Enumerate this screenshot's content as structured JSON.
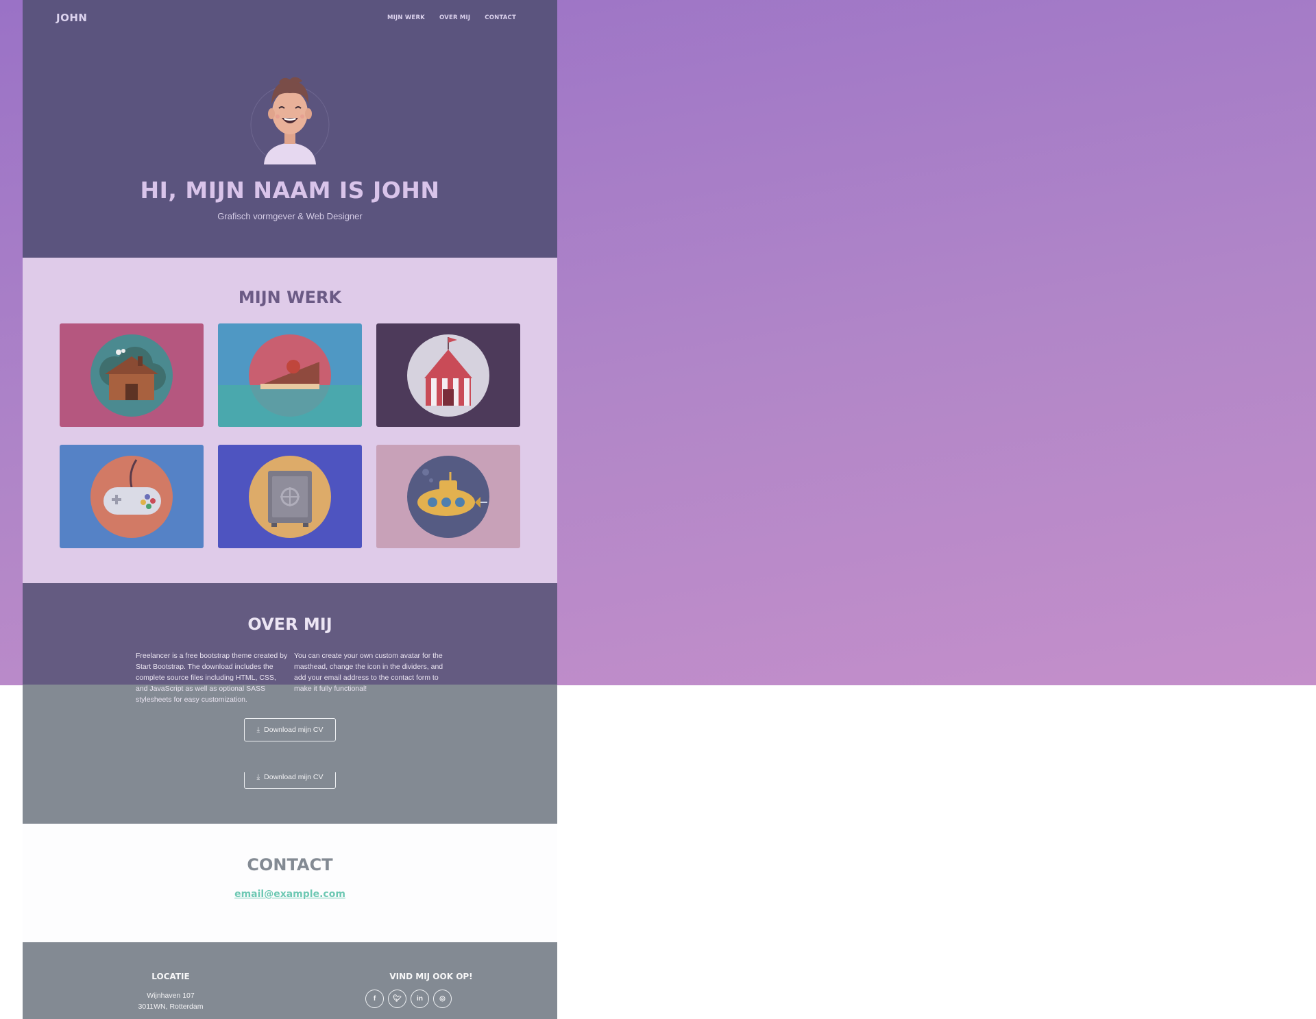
{
  "nav": {
    "brand": "JOHN",
    "links": [
      "MIJN WERK",
      "OVER MIJ",
      "CONTACT"
    ]
  },
  "hero": {
    "title": "HI, MIJN NAAM IS JOHN",
    "subtitle": "Grafisch vormgever & Web Designer",
    "avatar_icon": "avatar-illustration"
  },
  "work": {
    "title": "MIJN WERK",
    "items": [
      {
        "name": "cabin",
        "bg": "#b5577f",
        "circle": "#4b8a90"
      },
      {
        "name": "cake",
        "bg": "#4f98c4",
        "circle": "#c95f70"
      },
      {
        "name": "circus",
        "bg": "#4d3a5a",
        "circle": "#d6d2de"
      },
      {
        "name": "game",
        "bg": "#5582c6",
        "circle": "#d27a65"
      },
      {
        "name": "safe",
        "bg": "#4e54c0",
        "circle": "#ddab69"
      },
      {
        "name": "submarine",
        "bg": "#c8a1b8",
        "circle": "#555b83"
      }
    ]
  },
  "about": {
    "title": "OVER MIJ",
    "left_text": "Freelancer is a free bootstrap theme created by Start Bootstrap. The download includes the complete source files including HTML, CSS, and JavaScript as well as optional SASS stylesheets for easy customization.",
    "right_text": "You can create your own custom avatar for the masthead, change the icon in the dividers, and add your email address to the contact form to make it fully functional!",
    "button_label": "Download mijn CV",
    "button_label_2": "Download mijn CV"
  },
  "contact": {
    "title": "CONTACT",
    "email": "email@example.com"
  },
  "footer": {
    "location_title": "LOCATIE",
    "address_line1": "Wijnhaven 107",
    "address_line2": "3011WN, Rotterdam",
    "social_title": "VIND MIJ OOK OP!",
    "social_icons": [
      "facebook-icon",
      "twitter-icon",
      "linkedin-icon",
      "dribbble-icon"
    ]
  }
}
